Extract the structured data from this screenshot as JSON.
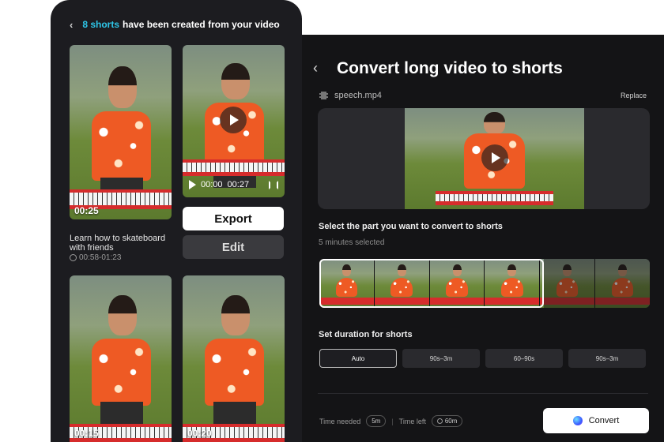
{
  "left_panel": {
    "count": "8 shorts",
    "header_rest": "have been created from your video",
    "clips": [
      {
        "duration": "00:25"
      },
      {
        "time_current": "00:00",
        "time_total": "00:27"
      },
      {
        "duration": "00:15"
      },
      {
        "duration": "00:20"
      }
    ],
    "export_label": "Export",
    "edit_label": "Edit",
    "clip_title": "Learn how to skateboard with friends",
    "clip_range": "00:58-01:23"
  },
  "right_panel": {
    "title": "Convert long video to shorts",
    "file_name": "speech.mp4",
    "replace_label": "Replace",
    "select_label": "Select the part you want to convert to shorts",
    "selected_text": "5 minutes selected",
    "duration_label": "Set duration for shorts",
    "duration_options": [
      "Auto",
      "90s–3m",
      "60–90s",
      "90s–3m"
    ],
    "time_needed_label": "Time needed",
    "time_needed_value": "5m",
    "time_left_label": "Time left",
    "time_left_value": "60m",
    "convert_label": "Convert"
  }
}
